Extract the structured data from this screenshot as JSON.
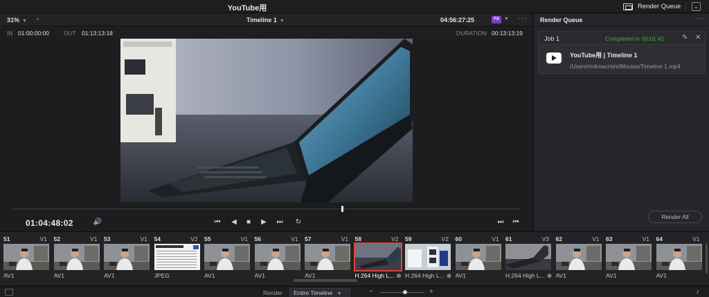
{
  "app": {
    "title": "YouTube用"
  },
  "toolbar": {
    "render_queue_label": "Render Queue"
  },
  "viewer": {
    "zoom": "31%",
    "timeline_name": "Timeline 1",
    "timecode_top": "04:56:27:25",
    "in_label": "IN",
    "in_value": "01:00:00:00",
    "out_label": "OUT",
    "out_value": "01:13:13:18",
    "duration_label": "DURATION",
    "duration_value": "00:13:13:19",
    "current_timecode": "01:04:48:02",
    "playhead_position": 0.65
  },
  "render_queue": {
    "title": "Render Queue",
    "job": {
      "name": "Job 1",
      "status": "Completed in 00:01:41",
      "title": "YouTube用 | Timeline 1",
      "path": "/Users/m4macmini/Movies/Timeline 1.mp4"
    },
    "render_all_label": "Render All"
  },
  "clips": [
    {
      "num": "51",
      "track": "V1",
      "codec": "AV1",
      "thumb": "person"
    },
    {
      "num": "52",
      "track": "V1",
      "codec": "AV1",
      "thumb": "person"
    },
    {
      "num": "53",
      "track": "V1",
      "codec": "AV1",
      "thumb": "person"
    },
    {
      "num": "54",
      "track": "V2",
      "codec": "JPEG",
      "thumb": "doc"
    },
    {
      "num": "55",
      "track": "V1",
      "codec": "AV1",
      "thumb": "person"
    },
    {
      "num": "56",
      "track": "V1",
      "codec": "AV1",
      "thumb": "person"
    },
    {
      "num": "57",
      "track": "V1",
      "codec": "AV1",
      "thumb": "person"
    },
    {
      "num": "58",
      "track": "V2",
      "codec": "H.264 High L...",
      "thumb": "laptop",
      "selected": true
    },
    {
      "num": "59",
      "track": "V2",
      "codec": "H.264 High L...",
      "thumb": "box"
    },
    {
      "num": "60",
      "track": "V1",
      "codec": "AV1",
      "thumb": "person"
    },
    {
      "num": "61",
      "track": "V3",
      "codec": "H.264 High L...",
      "thumb": "laptop2"
    },
    {
      "num": "62",
      "track": "V1",
      "codec": "AV1",
      "thumb": "person"
    },
    {
      "num": "63",
      "track": "V1",
      "codec": "AV1",
      "thumb": "person"
    },
    {
      "num": "64",
      "track": "V1",
      "codec": "AV1",
      "thumb": "person"
    }
  ],
  "footer": {
    "render_label": "Render",
    "render_select_value": "Entire Timeline"
  },
  "colors": {
    "accent_red": "#d8453a",
    "status_green": "#3fae3f",
    "fx_purple": "#7a3ec8"
  }
}
